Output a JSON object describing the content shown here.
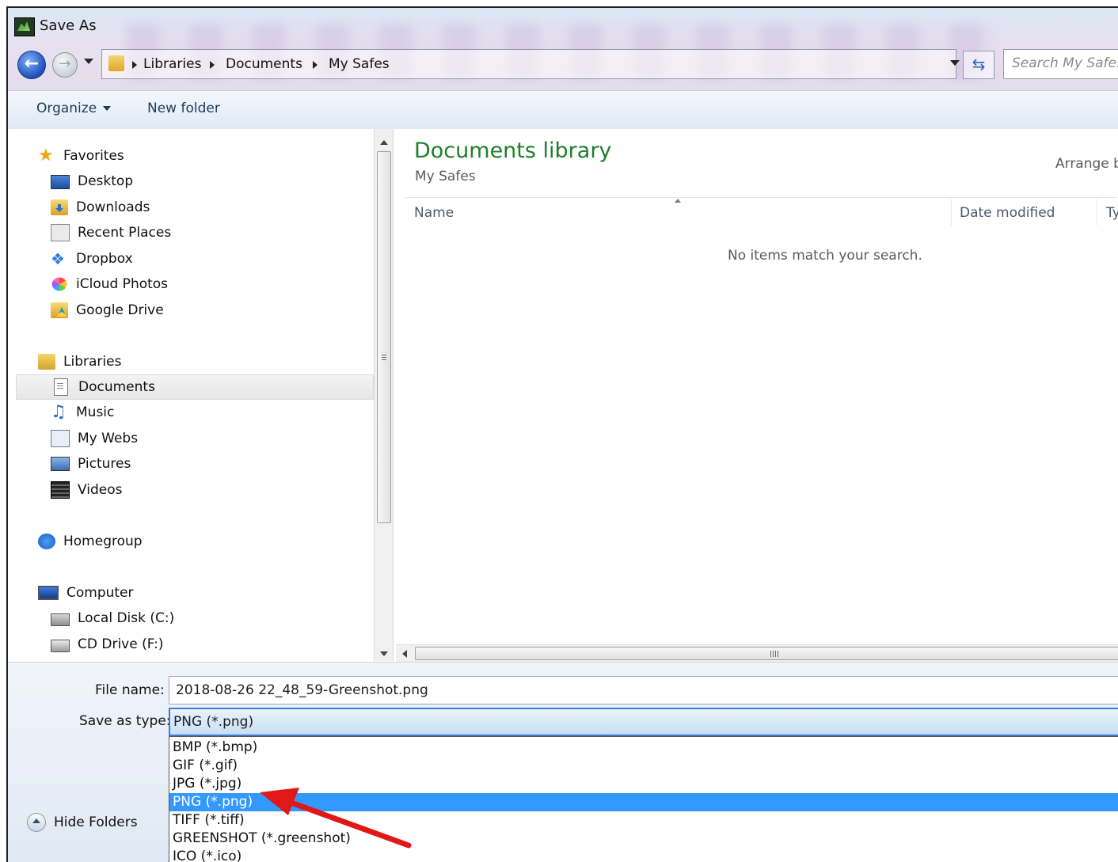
{
  "window": {
    "title": "Save As"
  },
  "address": {
    "crumbs": [
      "Libraries",
      "Documents",
      "My Safes"
    ],
    "search_placeholder": "Search My Safes"
  },
  "toolbar": {
    "organize_label": "Organize",
    "new_folder_label": "New folder"
  },
  "nav": {
    "favorites": {
      "label": "Favorites",
      "items": [
        "Desktop",
        "Downloads",
        "Recent Places",
        "Dropbox",
        "iCloud Photos",
        "Google Drive"
      ]
    },
    "libraries": {
      "label": "Libraries",
      "items": [
        "Documents",
        "Music",
        "My Webs",
        "Pictures",
        "Videos"
      ],
      "selected": "Documents"
    },
    "homegroup": {
      "label": "Homegroup"
    },
    "computer": {
      "label": "Computer",
      "items": [
        "Local Disk (C:)",
        "CD Drive (F:)"
      ]
    }
  },
  "content": {
    "library_title": "Documents library",
    "library_subtitle": "My Safes",
    "arrange_label": "Arrange b",
    "columns": [
      "Name",
      "Date modified",
      "Ty"
    ],
    "empty_message": "No items match your search."
  },
  "form": {
    "file_name_label": "File name:",
    "file_name_value": "2018-08-26 22_48_59-Greenshot.png",
    "save_type_label": "Save as type:",
    "save_type_value": "PNG (*.png)",
    "type_options": [
      "BMP (*.bmp)",
      "GIF (*.gif)",
      "JPG (*.jpg)",
      "PNG (*.png)",
      "TIFF (*.tiff)",
      "GREENSHOT (*.greenshot)",
      "ICO (*.ico)"
    ],
    "selected_option": "PNG (*.png)",
    "hide_folders_label": "Hide Folders"
  },
  "colors": {
    "selection": "#3399ff",
    "library_title": "#1e7f2a",
    "annotation_arrow": "#e01818"
  }
}
